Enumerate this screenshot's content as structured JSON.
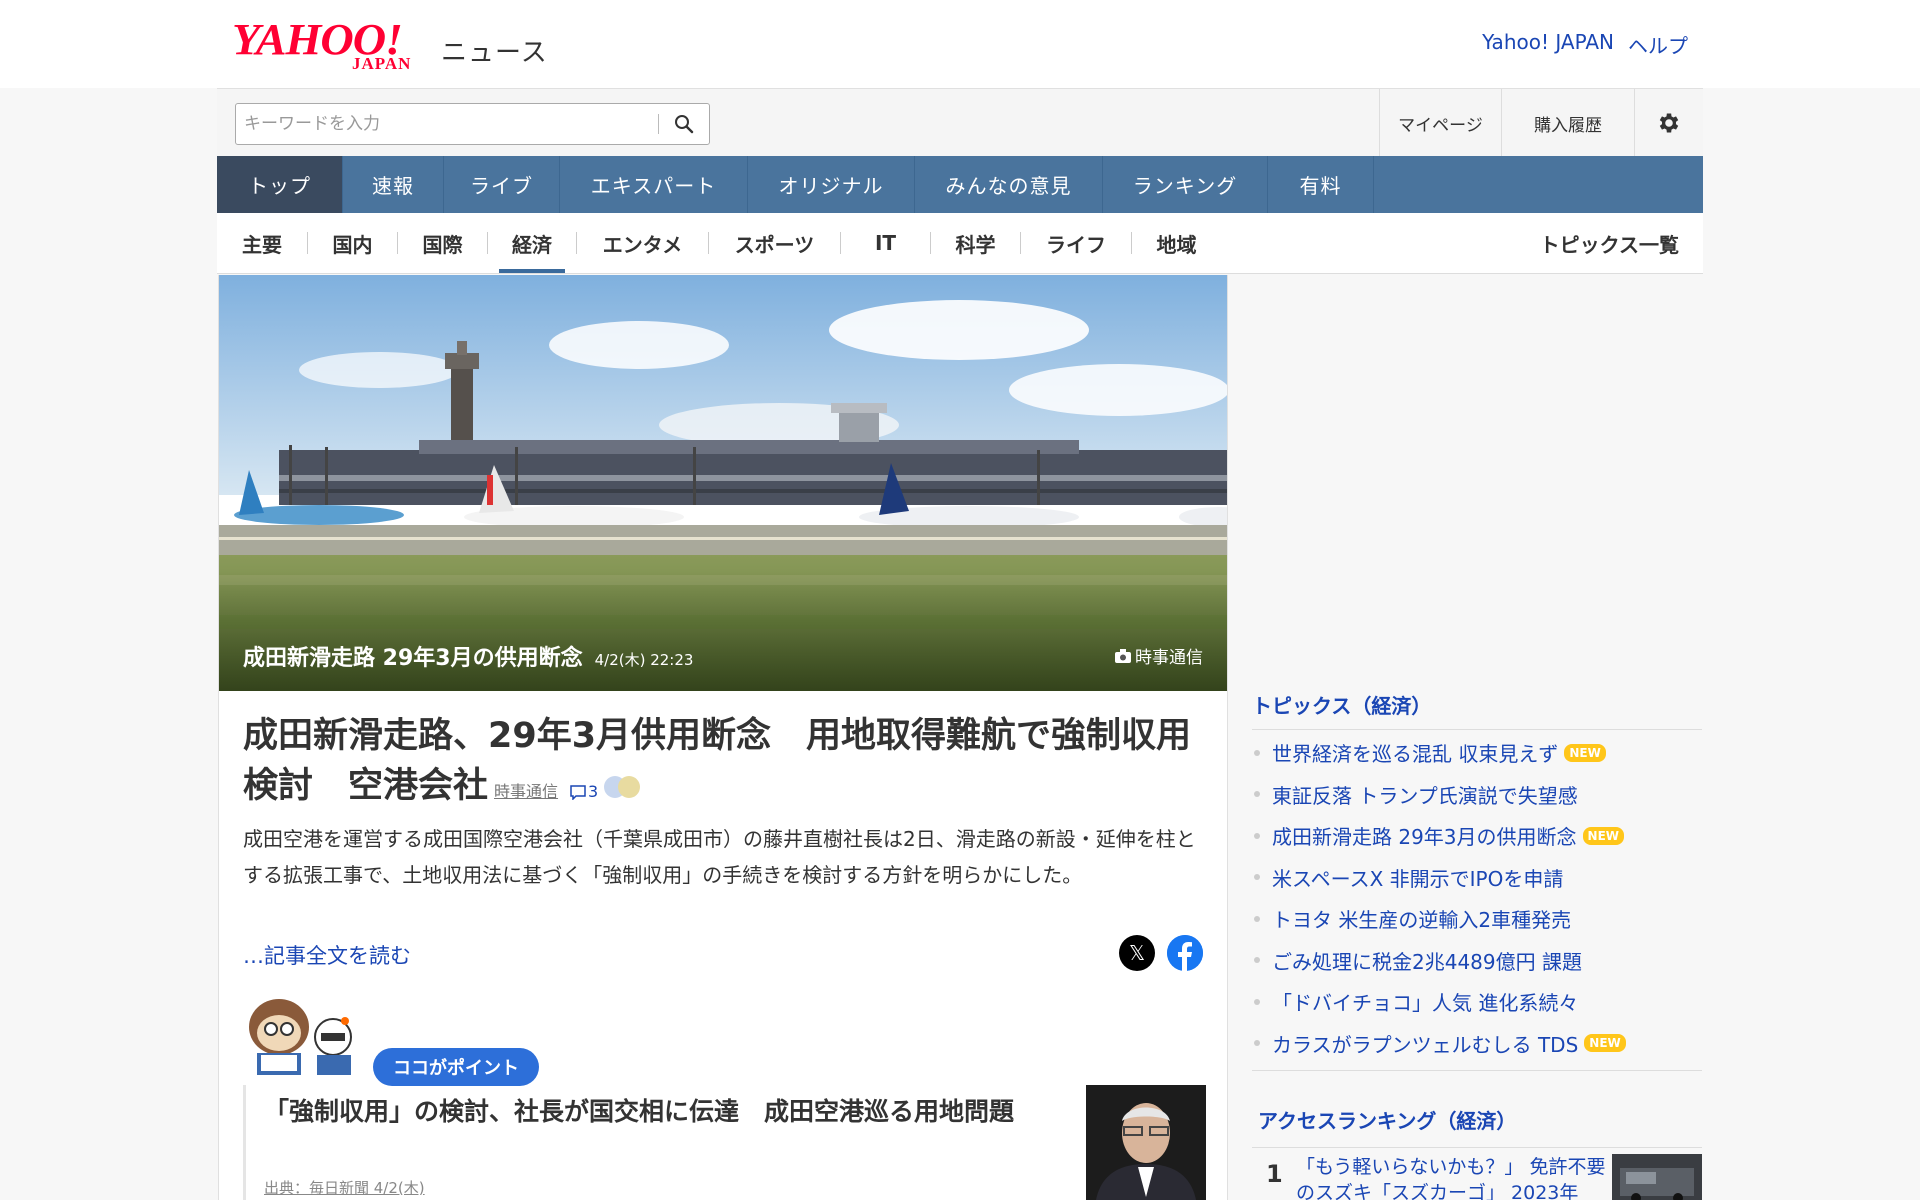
{
  "header": {
    "logo_main": "YAHOO!",
    "logo_sub": "JAPAN",
    "service_name": "ニュース",
    "link_yahoo": "Yahoo! JAPAN",
    "link_help": "ヘルプ"
  },
  "search": {
    "placeholder": "キーワードを入力",
    "icon": "search-icon"
  },
  "user_links": {
    "mypage": "マイページ",
    "history": "購入履歴",
    "settings_icon": "gear-icon"
  },
  "main_nav": [
    "トップ",
    "速報",
    "ライブ",
    "エキスパート",
    "オリジナル",
    "みんなの意見",
    "ランキング",
    "有料"
  ],
  "sub_nav": [
    "主要",
    "国内",
    "国際",
    "経済",
    "エンタメ",
    "スポーツ",
    "IT",
    "科学",
    "ライフ",
    "地域"
  ],
  "sub_nav_active": "経済",
  "topics_list_link": "トピックス一覧",
  "hero": {
    "caption": "成田新滑走路 29年3月の供用断念",
    "date": "4/2(木) 22:23",
    "credit": "時事通信"
  },
  "article": {
    "title": "成田新滑走路、29年3月供用断念　用地取得難航で強制収用検討　空港会社",
    "source": "時事通信",
    "comment_count": "3",
    "summary": "成田空港を運営する成田国際空港会社（千葉県成田市）の藤井直樹社長は2日、滑走路の新設・延伸を柱とする拡張工事で、土地収用法に基づく「強制収用」の手続きを検討する方針を明らかにした。",
    "read_more": "…記事全文を読む"
  },
  "point": {
    "badge": "ココがポイント"
  },
  "related": {
    "title": "「強制収用」の検討、社長が国交相に伝達　成田空港巡る用地問題",
    "meta": "出典：毎日新聞 4/2(木)"
  },
  "sidebar": {
    "topics_heading": "トピックス（経済）",
    "topics": [
      {
        "text": "世界経済を巡る混乱 収束見えず",
        "new": "NEW"
      },
      {
        "text": "東証反落 トランプ氏演説で失望感",
        "new": ""
      },
      {
        "text": "成田新滑走路 29年3月の供用断念",
        "new": "NEW"
      },
      {
        "text": "米スペースX 非開示でIPOを申請",
        "new": ""
      },
      {
        "text": "トヨタ 米生産の逆輸入2車種発売",
        "new": ""
      },
      {
        "text": "ごみ処理に税金2兆4489億円 課題",
        "new": ""
      },
      {
        "text": "「ドバイチョコ」人気 進化系続々",
        "new": ""
      },
      {
        "text": "カラスがラプンツェルむしる TDS",
        "new": "NEW"
      }
    ],
    "ranking_heading": "アクセスランキング（経済）",
    "ranking": [
      {
        "rank": "1",
        "title": "「もう軽いらないかも？」 免許不要のスズキ「スズカーゴ」 2023年"
      }
    ]
  },
  "colors": {
    "brand_red": "#ff0033",
    "nav_blue": "#4a749d",
    "nav_active": "#3a4a5f",
    "link_blue": "#1a46b4",
    "new_badge": "#ffc61a",
    "point_badge": "#2d6fd9"
  }
}
